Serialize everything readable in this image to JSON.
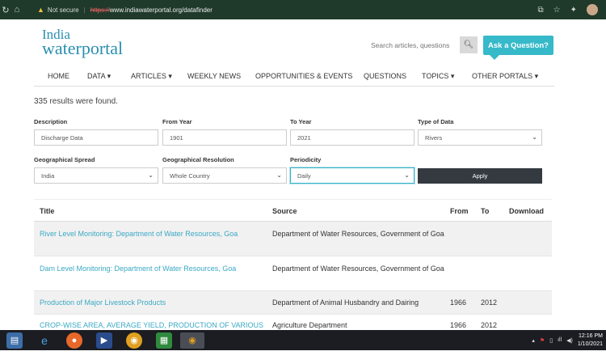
{
  "browser": {
    "not_secure": "Not secure",
    "https": "https://",
    "url": "www.indiawaterportal.org/datafinder"
  },
  "header": {
    "logo_line1": "India",
    "logo_line2": "waterportal",
    "search_placeholder": "Search articles, questions",
    "ask_label": "Ask a Question?"
  },
  "nav": {
    "items": [
      "HOME",
      "DATA ▾",
      "ARTICLES ▾",
      "WEEKLY NEWS",
      "OPPORTUNITIES & EVENTS",
      "QUESTIONS",
      "TOPICS ▾",
      "OTHER PORTALS ▾"
    ]
  },
  "results_text": "335 results were found.",
  "form": {
    "description_label": "Description",
    "description_value": "Discharge Data",
    "from_year_label": "From Year",
    "from_year_value": "1901",
    "to_year_label": "To Year",
    "to_year_value": "2021",
    "type_label": "Type of Data",
    "type_value": "Rivers",
    "geo_spread_label": "Geographical Spread",
    "geo_spread_value": "India",
    "geo_res_label": "Geographical Resolution",
    "geo_res_value": "Whole Country",
    "periodicity_label": "Periodicity",
    "periodicity_value": "Daily",
    "apply_label": "Apply"
  },
  "table": {
    "headers": {
      "title": "Title",
      "source": "Source",
      "from": "From",
      "to": "To",
      "download": "Download"
    },
    "rows": [
      {
        "title": "River Level Monitoring: Department of Water Resources, Goa",
        "source": "Department of Water Resources, Government of Goa",
        "from": "",
        "to": ""
      },
      {
        "title": "Dam Level Monitoring: Department of Water Resources, Goa",
        "source": "Department of Water Resources, Government of Goa",
        "from": "",
        "to": ""
      },
      {
        "title": "Production of Major Livestock Products",
        "source": "Department of Animal Husbandry and Dairing",
        "from": "1966",
        "to": "2012"
      },
      {
        "title": "CROP-WISE AREA, AVERAGE YIELD, PRODUCTION OF VARIOUS",
        "source": "Agriculture Department",
        "from": "1966",
        "to": "2012"
      }
    ]
  },
  "taskbar": {
    "time": "12:16 PM",
    "date": "1/10/2021"
  }
}
